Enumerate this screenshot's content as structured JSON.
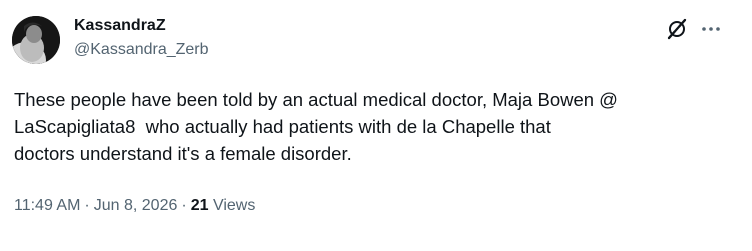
{
  "author": {
    "display_name": "KassandraZ",
    "handle": "@Kassandra_Zerb",
    "avatar_icon": "avatar-image"
  },
  "header_icons": {
    "grok": "grok-icon",
    "more": "more-icon"
  },
  "tweet": {
    "text": "These people have been told by an actual medical doctor, Maja Bowen @\nLaScapigliata8  who actually had patients with de la Chapelle that\ndoctors understand it's a female disorder."
  },
  "meta": {
    "time": "11:49 AM",
    "date": "Jun 8, 2026",
    "separator": "·",
    "views_count": "21",
    "views_label": "Views"
  },
  "colors": {
    "primary_text": "#0f1419",
    "secondary_text": "#536471",
    "background": "#ffffff"
  }
}
